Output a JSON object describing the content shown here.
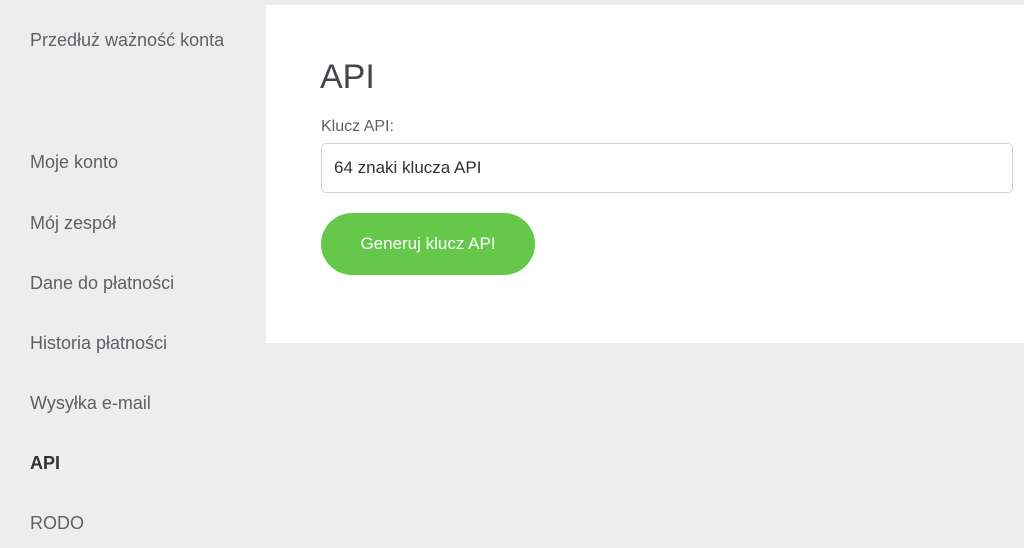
{
  "sidebar": {
    "items": [
      {
        "label": "Przedłuż ważność konta"
      },
      {
        "label": "Moje konto"
      },
      {
        "label": "Mój zespół"
      },
      {
        "label": "Dane do płatności"
      },
      {
        "label": "Historia płatności"
      },
      {
        "label": "Wysyłka e-mail"
      },
      {
        "label": "API",
        "active": true
      },
      {
        "label": "RODO"
      }
    ]
  },
  "main": {
    "title": "API",
    "api_key": {
      "label": "Klucz API:",
      "value": "64 znaki klucza API"
    },
    "generate_button": "Generuj klucz API"
  },
  "colors": {
    "background": "#ededed",
    "panel": "#ffffff",
    "accent": "#66c84a",
    "text": "#5e6166",
    "active_text": "#2f3136"
  }
}
